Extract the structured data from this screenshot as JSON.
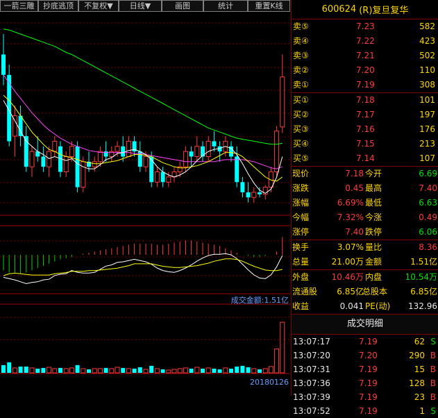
{
  "toolbar": {
    "buttons": [
      "一箭三雕",
      "抄底逃顶",
      "不复权▼",
      "日线▼",
      "画图",
      "统计",
      "重置K线"
    ]
  },
  "stock": {
    "code": "600624",
    "name": "(R)复旦复华"
  },
  "orderbook": {
    "sell": [
      {
        "label": "卖⑤",
        "price": "7.23",
        "volume": "582"
      },
      {
        "label": "卖④",
        "price": "7.22",
        "volume": "423"
      },
      {
        "label": "卖③",
        "price": "7.21",
        "volume": "502"
      },
      {
        "label": "卖②",
        "price": "7.20",
        "volume": "110"
      },
      {
        "label": "卖①",
        "price": "7.19",
        "volume": "308"
      }
    ],
    "buy": [
      {
        "label": "买①",
        "price": "7.18",
        "volume": "101"
      },
      {
        "label": "买②",
        "price": "7.17",
        "volume": "197"
      },
      {
        "label": "买③",
        "price": "7.16",
        "volume": "176"
      },
      {
        "label": "买④",
        "price": "7.15",
        "volume": "213"
      },
      {
        "label": "买⑤",
        "price": "7.14",
        "volume": "107"
      }
    ]
  },
  "quote": {
    "price_label": "现价",
    "price": "7.18",
    "open_label": "今开",
    "open": "6.69",
    "change_label": "涨跌",
    "change": "0.45",
    "high_label": "最高",
    "high": "7.40",
    "pct_label": "涨幅",
    "pct": "6.69%",
    "low_label": "最低",
    "low": "6.63",
    "amp_label": "今幅",
    "amp": "7.32%",
    "limitup_label": "今涨",
    "limitup": "0.49",
    "upstop_label": "涨停",
    "upstop": "7.40",
    "downstop_label": "跌停",
    "downstop": "6.06",
    "turnover_label": "换手",
    "turnover": "3.07%",
    "volratio_label": "量比",
    "volratio": "8.36",
    "totalvol_label": "总量",
    "totalvol": "21.00万",
    "amount_label": "金额",
    "amount": "1.51亿",
    "outer_label": "外盘",
    "outer": "10.46万",
    "inner_label": "内盘",
    "inner": "10.54万",
    "float_label": "流通股",
    "float": "6.85亿",
    "capital_label": "总股本",
    "capital": "6.85亿",
    "eps_label": "收益",
    "eps": "0.041",
    "pe_label": "PE(动)",
    "pe": "132.96"
  },
  "trades_title": "成交明细",
  "trades": [
    {
      "time": "13:07:17",
      "price": "7.19",
      "volume": "62",
      "dir": "S"
    },
    {
      "time": "13:07:20",
      "price": "7.20",
      "volume": "290",
      "dir": "B"
    },
    {
      "time": "13:07:31",
      "price": "7.19",
      "volume": "15",
      "dir": "B"
    },
    {
      "time": "13:07:36",
      "price": "7.19",
      "volume": "128",
      "dir": "B"
    },
    {
      "time": "13:07:39",
      "price": "7.19",
      "volume": "23",
      "dir": "B"
    },
    {
      "time": "13:07:52",
      "price": "7.19",
      "volume": "1",
      "dir": "S"
    }
  ],
  "chart": {
    "amount_caption": "成交金额:1.51亿",
    "date": "20180126",
    "colors": {
      "up": "#ff3b3b",
      "down": "#00ffff",
      "ma5": "#ffffff",
      "ma10": "#ffff00",
      "ma20": "#ff44ff",
      "ma60": "#00ff00"
    }
  },
  "chart_data": {
    "type": "candlestick",
    "candles": [
      [
        7.4,
        7.6,
        7.1,
        7.2
      ],
      [
        7.2,
        7.3,
        6.5,
        6.55
      ],
      [
        6.6,
        6.9,
        6.4,
        6.8
      ],
      [
        6.8,
        6.9,
        6.5,
        6.6
      ],
      [
        6.6,
        6.7,
        6.25,
        6.3
      ],
      [
        6.3,
        6.5,
        6.2,
        6.45
      ],
      [
        6.45,
        6.6,
        6.35,
        6.4
      ],
      [
        6.4,
        6.5,
        6.25,
        6.3
      ],
      [
        6.3,
        6.5,
        6.2,
        6.45
      ],
      [
        6.45,
        6.6,
        6.4,
        6.55
      ],
      [
        6.5,
        6.55,
        6.2,
        6.25
      ],
      [
        6.25,
        6.45,
        6.2,
        6.4
      ],
      [
        6.4,
        6.55,
        6.35,
        6.5
      ],
      [
        6.5,
        6.55,
        6.05,
        6.1
      ],
      [
        6.1,
        6.4,
        6.05,
        6.35
      ],
      [
        6.35,
        6.45,
        6.25,
        6.3
      ],
      [
        6.3,
        6.4,
        6.25,
        6.35
      ],
      [
        6.35,
        6.5,
        6.3,
        6.45
      ],
      [
        6.45,
        6.55,
        6.35,
        6.4
      ],
      [
        6.4,
        6.5,
        6.35,
        6.45
      ],
      [
        6.45,
        6.55,
        6.4,
        6.5
      ],
      [
        6.5,
        6.6,
        6.35,
        6.4
      ],
      [
        6.4,
        6.6,
        6.4,
        6.55
      ],
      [
        6.55,
        6.6,
        6.4,
        6.45
      ],
      [
        6.45,
        6.55,
        6.25,
        6.3
      ],
      [
        6.3,
        6.45,
        6.25,
        6.4
      ],
      [
        6.4,
        6.45,
        6.1,
        6.15
      ],
      [
        6.15,
        6.3,
        6.1,
        6.25
      ],
      [
        6.25,
        6.3,
        6.1,
        6.15
      ],
      [
        6.15,
        6.25,
        6.1,
        6.2
      ],
      [
        6.2,
        6.3,
        6.15,
        6.25
      ],
      [
        6.25,
        6.35,
        6.2,
        6.3
      ],
      [
        6.3,
        6.5,
        6.25,
        6.45
      ],
      [
        6.45,
        6.5,
        6.3,
        6.4
      ],
      [
        6.4,
        6.6,
        6.35,
        6.5
      ],
      [
        6.5,
        6.55,
        6.35,
        6.4
      ],
      [
        6.4,
        6.6,
        6.35,
        6.55
      ],
      [
        6.55,
        6.65,
        6.45,
        6.5
      ],
      [
        6.5,
        6.55,
        6.35,
        6.45
      ],
      [
        6.45,
        6.6,
        6.4,
        6.55
      ],
      [
        6.5,
        6.55,
        6.35,
        6.4
      ],
      [
        6.4,
        6.5,
        6.1,
        6.15
      ],
      [
        6.15,
        6.2,
        6.0,
        6.05
      ],
      [
        6.05,
        6.15,
        5.95,
        6.0
      ],
      [
        6.0,
        6.1,
        5.95,
        6.05
      ],
      [
        6.05,
        6.1,
        6.0,
        6.03
      ],
      [
        6.03,
        6.12,
        5.98,
        6.1
      ],
      [
        6.1,
        6.3,
        6.05,
        6.25
      ],
      [
        6.25,
        6.7,
        6.2,
        6.65
      ],
      [
        6.69,
        7.4,
        6.63,
        7.18
      ]
    ],
    "ma5": [
      6.95,
      6.85,
      6.75,
      6.65,
      6.55,
      6.5,
      6.45,
      6.42,
      6.38,
      6.4,
      6.38,
      6.36,
      6.38,
      6.33,
      6.3,
      6.28,
      6.28,
      6.32,
      6.37,
      6.39,
      6.43,
      6.44,
      6.46,
      6.47,
      6.45,
      6.42,
      6.37,
      6.3,
      6.25,
      6.22,
      6.2,
      6.22,
      6.25,
      6.3,
      6.36,
      6.41,
      6.45,
      6.47,
      6.48,
      6.5,
      6.48,
      6.42,
      6.33,
      6.23,
      6.14,
      6.07,
      6.04,
      6.08,
      6.2,
      6.4
    ],
    "ma10": [
      7.0,
      6.95,
      6.88,
      6.8,
      6.72,
      6.64,
      6.58,
      6.52,
      6.47,
      6.45,
      6.42,
      6.4,
      6.39,
      6.37,
      6.35,
      6.34,
      6.33,
      6.33,
      6.34,
      6.35,
      6.36,
      6.38,
      6.4,
      6.42,
      6.42,
      6.41,
      6.4,
      6.37,
      6.34,
      6.32,
      6.3,
      6.29,
      6.29,
      6.3,
      6.31,
      6.33,
      6.35,
      6.38,
      6.41,
      6.44,
      6.44,
      6.43,
      6.4,
      6.35,
      6.3,
      6.25,
      6.2,
      6.17,
      6.16,
      6.2
    ],
    "ma20": [
      7.2,
      7.12,
      7.04,
      6.97,
      6.9,
      6.83,
      6.77,
      6.71,
      6.66,
      6.62,
      6.58,
      6.55,
      6.52,
      6.5,
      6.48,
      6.46,
      6.45,
      6.44,
      6.44,
      6.44,
      6.44,
      6.44,
      6.44,
      6.43,
      6.43,
      6.42,
      6.41,
      6.4,
      6.39,
      6.38,
      6.37,
      6.36,
      6.35,
      6.35,
      6.35,
      6.35,
      6.35,
      6.35,
      6.36,
      6.37,
      6.37,
      6.37,
      6.37,
      6.36,
      6.35,
      6.33,
      6.31,
      6.29,
      6.28,
      6.3
    ],
    "ma60": [
      7.65,
      7.64,
      7.62,
      7.6,
      7.58,
      7.56,
      7.54,
      7.52,
      7.5,
      7.48,
      7.45,
      7.42,
      7.4,
      7.37,
      7.34,
      7.31,
      7.28,
      7.25,
      7.22,
      7.19,
      7.16,
      7.13,
      7.1,
      7.07,
      7.04,
      7.01,
      6.98,
      6.95,
      6.92,
      6.89,
      6.86,
      6.83,
      6.8,
      6.77,
      6.74,
      6.71,
      6.68,
      6.66,
      6.64,
      6.62,
      6.6,
      6.58,
      6.57,
      6.56,
      6.55,
      6.54,
      6.53,
      6.52,
      6.52,
      6.53
    ],
    "macd": [
      -0.14,
      -0.16,
      -0.17,
      -0.17,
      -0.16,
      -0.14,
      -0.12,
      -0.1,
      -0.08,
      -0.06,
      -0.04,
      -0.03,
      -0.02,
      0.0,
      0.01,
      0.02,
      0.03,
      0.04,
      0.05,
      0.06,
      0.07,
      0.08,
      0.09,
      0.1,
      0.1,
      0.1,
      0.1,
      0.09,
      0.09,
      0.1,
      0.11,
      0.12,
      0.13,
      0.13,
      0.12,
      0.11,
      0.1,
      0.09,
      0.08,
      0.06,
      0.04,
      0.02,
      0.0,
      -0.01,
      -0.02,
      -0.02,
      -0.01,
      0.0,
      0.03,
      0.16
    ],
    "volume": [
      0.55,
      0.75,
      0.35,
      0.45,
      0.45,
      0.35,
      0.3,
      0.35,
      0.4,
      0.3,
      0.35,
      0.3,
      0.35,
      0.55,
      0.3,
      0.25,
      0.3,
      0.3,
      0.35,
      0.3,
      0.4,
      0.35,
      0.3,
      0.3,
      0.4,
      0.25,
      0.5,
      0.3,
      0.25,
      0.2,
      0.25,
      0.3,
      0.35,
      0.3,
      0.4,
      0.3,
      0.35,
      0.3,
      0.25,
      0.35,
      0.3,
      0.45,
      0.5,
      0.4,
      0.3,
      0.25,
      0.3,
      0.45,
      1.7,
      3.6
    ]
  }
}
